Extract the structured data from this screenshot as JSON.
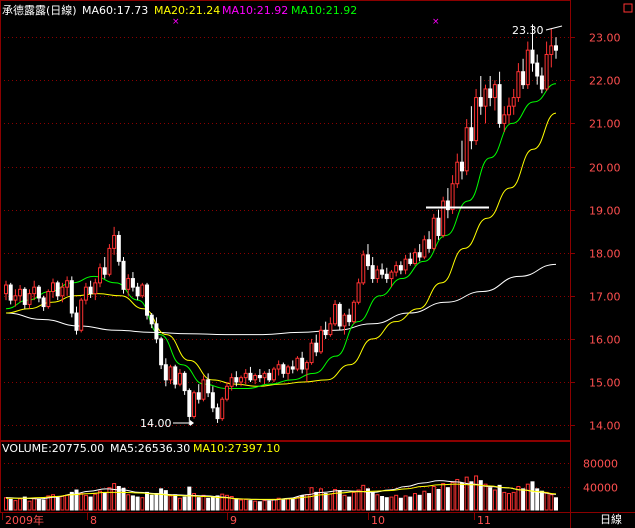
{
  "header": {
    "title": "承德露露(日線)",
    "ma60": "MA60:17.73",
    "ma20": "MA20:21.24",
    "ma10a": "MA10:21.92",
    "ma10b": "MA10:21.92"
  },
  "volume_header": {
    "volume": "VOLUME:20775.00",
    "ma5": "MA5:26536.30",
    "ma10": "MA10:27397.10"
  },
  "annotations": {
    "high": "23.30",
    "low": "14.00"
  },
  "period_label": "日線",
  "colors": {
    "bg": "#000000",
    "up": "#ff3232",
    "down": "#ffffff",
    "grid": "#8b0000",
    "axis_text": "#ff5050",
    "ma_white": "#ffffff",
    "ma_yellow": "#ffff00",
    "ma_green": "#00ff00",
    "magenta": "#ff00ff"
  },
  "chart_data": {
    "type": "candlestick",
    "price_ticks": [
      "23.00",
      "22.00",
      "21.00",
      "20.00",
      "19.00",
      "18.00",
      "17.00",
      "16.00",
      "15.00",
      "14.00"
    ],
    "volume_ticks": [
      "80000",
      "40000"
    ],
    "x_labels": [
      "2009年",
      "8",
      "9",
      "10",
      "11"
    ],
    "ylim": [
      13.7,
      23.4
    ],
    "vol_ylim": [
      0,
      92000
    ],
    "horizontal_line": 19.05,
    "candles": [
      [
        17.05,
        17.35,
        16.9,
        17.25,
        21000
      ],
      [
        17.25,
        17.3,
        16.8,
        16.9,
        18000
      ],
      [
        16.9,
        17.15,
        16.75,
        17.0,
        16000
      ],
      [
        17.0,
        17.25,
        16.85,
        17.15,
        19000
      ],
      [
        17.15,
        17.2,
        16.7,
        16.8,
        22000
      ],
      [
        16.8,
        17.15,
        16.7,
        17.05,
        15000
      ],
      [
        17.05,
        17.35,
        16.9,
        17.2,
        20000
      ],
      [
        17.2,
        17.25,
        16.85,
        16.95,
        18000
      ],
      [
        16.95,
        17.0,
        16.65,
        16.75,
        17000
      ],
      [
        16.75,
        17.15,
        16.7,
        17.1,
        24000
      ],
      [
        17.1,
        17.4,
        16.95,
        17.3,
        26000
      ],
      [
        17.3,
        17.35,
        16.9,
        17.0,
        21000
      ],
      [
        17.0,
        17.3,
        16.85,
        17.2,
        23000
      ],
      [
        17.2,
        17.45,
        17.0,
        17.35,
        25000
      ],
      [
        17.35,
        17.45,
        16.5,
        16.6,
        30000
      ],
      [
        16.6,
        16.75,
        16.1,
        16.2,
        34000
      ],
      [
        16.2,
        16.95,
        16.15,
        16.9,
        28000
      ],
      [
        16.9,
        17.3,
        16.8,
        17.2,
        25000
      ],
      [
        17.2,
        17.35,
        16.95,
        17.05,
        22000
      ],
      [
        17.05,
        17.4,
        16.9,
        17.3,
        27000
      ],
      [
        17.3,
        17.75,
        17.2,
        17.65,
        32000
      ],
      [
        17.65,
        17.9,
        17.4,
        17.5,
        29000
      ],
      [
        17.5,
        18.2,
        17.45,
        18.1,
        38000
      ],
      [
        18.1,
        18.6,
        17.95,
        18.4,
        45000
      ],
      [
        18.4,
        18.5,
        17.7,
        17.8,
        40000
      ],
      [
        17.8,
        17.9,
        17.05,
        17.15,
        37000
      ],
      [
        17.15,
        17.5,
        17.0,
        17.4,
        26000
      ],
      [
        17.4,
        17.55,
        17.1,
        17.2,
        24000
      ],
      [
        17.2,
        17.3,
        16.9,
        17.0,
        22000
      ],
      [
        17.0,
        17.3,
        16.95,
        17.25,
        21000
      ],
      [
        17.25,
        17.3,
        16.45,
        16.55,
        30000
      ],
      [
        16.55,
        16.6,
        16.25,
        16.35,
        25000
      ],
      [
        16.35,
        16.5,
        15.9,
        16.0,
        28000
      ],
      [
        16.0,
        16.05,
        15.3,
        15.4,
        36000
      ],
      [
        15.4,
        15.55,
        14.9,
        15.05,
        33000
      ],
      [
        15.05,
        15.4,
        14.95,
        15.35,
        24000
      ],
      [
        15.35,
        15.4,
        14.85,
        14.95,
        26000
      ],
      [
        14.95,
        15.3,
        14.9,
        15.2,
        20000
      ],
      [
        15.2,
        15.25,
        14.7,
        14.8,
        22000
      ],
      [
        14.8,
        14.85,
        14.0,
        14.2,
        39000
      ],
      [
        14.2,
        14.8,
        14.15,
        14.75,
        28000
      ],
      [
        14.75,
        14.95,
        14.5,
        14.6,
        21000
      ],
      [
        14.6,
        15.15,
        14.55,
        15.05,
        25000
      ],
      [
        15.05,
        15.2,
        14.65,
        14.75,
        20000
      ],
      [
        14.75,
        14.9,
        14.3,
        14.4,
        22000
      ],
      [
        14.4,
        14.5,
        14.05,
        14.15,
        24000
      ],
      [
        14.15,
        14.65,
        14.1,
        14.6,
        27000
      ],
      [
        14.6,
        15.0,
        14.55,
        14.9,
        25000
      ],
      [
        14.9,
        15.2,
        14.8,
        15.1,
        23000
      ],
      [
        15.1,
        15.25,
        14.9,
        15.0,
        19000
      ],
      [
        15.0,
        15.15,
        14.9,
        15.1,
        17000
      ],
      [
        15.1,
        15.3,
        14.95,
        15.2,
        18000
      ],
      [
        15.2,
        15.35,
        15.0,
        15.05,
        16000
      ],
      [
        15.05,
        15.2,
        14.95,
        15.15,
        15000
      ],
      [
        15.15,
        15.3,
        15.0,
        15.1,
        14000
      ],
      [
        15.1,
        15.25,
        14.95,
        15.2,
        16000
      ],
      [
        15.2,
        15.3,
        15.0,
        15.05,
        15000
      ],
      [
        15.05,
        15.35,
        15.0,
        15.3,
        18000
      ],
      [
        15.3,
        15.5,
        15.15,
        15.4,
        20000
      ],
      [
        15.4,
        15.45,
        15.1,
        15.2,
        17000
      ],
      [
        15.2,
        15.4,
        15.05,
        15.35,
        19000
      ],
      [
        15.35,
        15.5,
        15.2,
        15.3,
        18000
      ],
      [
        15.3,
        15.6,
        15.25,
        15.55,
        22000
      ],
      [
        15.55,
        15.7,
        15.2,
        15.3,
        24000
      ],
      [
        15.3,
        15.5,
        15.0,
        15.45,
        26000
      ],
      [
        15.45,
        16.0,
        15.4,
        15.9,
        38000
      ],
      [
        15.9,
        16.1,
        15.6,
        15.7,
        30000
      ],
      [
        15.7,
        16.3,
        15.65,
        16.2,
        36000
      ],
      [
        16.2,
        16.4,
        16.0,
        16.1,
        28000
      ],
      [
        16.1,
        16.5,
        16.05,
        16.35,
        27000
      ],
      [
        16.35,
        16.9,
        16.3,
        16.8,
        35000
      ],
      [
        16.8,
        16.85,
        16.2,
        16.3,
        33000
      ],
      [
        16.3,
        16.6,
        16.1,
        16.55,
        25000
      ],
      [
        16.55,
        16.7,
        16.3,
        16.4,
        22000
      ],
      [
        16.4,
        16.9,
        16.35,
        16.85,
        30000
      ],
      [
        16.85,
        17.4,
        16.8,
        17.3,
        34000
      ],
      [
        17.3,
        18.05,
        17.25,
        17.95,
        42000
      ],
      [
        17.95,
        18.2,
        17.6,
        17.7,
        36000
      ],
      [
        17.7,
        17.9,
        17.3,
        17.4,
        30000
      ],
      [
        17.4,
        17.7,
        17.3,
        17.6,
        26000
      ],
      [
        17.6,
        17.75,
        17.4,
        17.5,
        23000
      ],
      [
        17.5,
        17.65,
        17.3,
        17.4,
        21000
      ],
      [
        17.4,
        17.6,
        17.2,
        17.55,
        22000
      ],
      [
        17.55,
        17.8,
        17.45,
        17.7,
        25000
      ],
      [
        17.7,
        17.8,
        17.5,
        17.6,
        20000
      ],
      [
        17.6,
        17.95,
        17.5,
        17.85,
        24000
      ],
      [
        17.85,
        18.0,
        17.7,
        17.75,
        22000
      ],
      [
        17.75,
        18.1,
        17.7,
        18.0,
        28000
      ],
      [
        18.0,
        18.2,
        17.8,
        17.9,
        25000
      ],
      [
        17.9,
        18.4,
        17.85,
        18.3,
        32000
      ],
      [
        18.3,
        18.5,
        18.0,
        18.1,
        28000
      ],
      [
        18.1,
        18.9,
        18.05,
        18.8,
        40000
      ],
      [
        18.8,
        19.0,
        18.3,
        18.4,
        35000
      ],
      [
        18.4,
        19.3,
        18.35,
        19.2,
        45000
      ],
      [
        19.2,
        19.5,
        18.8,
        19.0,
        38000
      ],
      [
        19.0,
        19.8,
        18.9,
        19.6,
        47000
      ],
      [
        19.6,
        20.3,
        19.5,
        20.1,
        52000
      ],
      [
        20.1,
        20.6,
        19.7,
        19.9,
        46000
      ],
      [
        19.9,
        21.1,
        19.8,
        20.9,
        56000
      ],
      [
        20.9,
        21.4,
        20.4,
        20.6,
        48000
      ],
      [
        20.6,
        21.8,
        20.5,
        21.6,
        58000
      ],
      [
        21.6,
        22.1,
        21.2,
        21.4,
        50000
      ],
      [
        21.4,
        21.9,
        21.0,
        21.8,
        44000
      ],
      [
        21.8,
        22.1,
        21.4,
        21.6,
        38000
      ],
      [
        21.6,
        22.0,
        21.3,
        21.9,
        34000
      ],
      [
        21.9,
        22.2,
        20.9,
        21.0,
        42000
      ],
      [
        21.0,
        21.4,
        20.8,
        21.2,
        30000
      ],
      [
        21.2,
        21.6,
        21.0,
        21.4,
        28000
      ],
      [
        21.4,
        21.8,
        21.2,
        21.6,
        30000
      ],
      [
        21.6,
        22.4,
        21.5,
        22.2,
        40000
      ],
      [
        22.2,
        22.5,
        21.8,
        21.9,
        36000
      ],
      [
        21.9,
        22.9,
        21.8,
        22.7,
        44000
      ],
      [
        22.7,
        23.3,
        22.2,
        22.4,
        48000
      ],
      [
        22.4,
        22.6,
        21.9,
        22.1,
        36000
      ],
      [
        22.1,
        22.3,
        21.7,
        21.8,
        32000
      ],
      [
        21.8,
        22.9,
        21.75,
        22.6,
        30000
      ],
      [
        22.6,
        23.2,
        22.3,
        22.8,
        26000
      ],
      [
        22.8,
        23.0,
        22.5,
        22.7,
        20775
      ]
    ],
    "ma_white": [
      16.6,
      16.45,
      16.3,
      16.2,
      16.15,
      16.12,
      16.1,
      16.1,
      16.15,
      16.2,
      16.35,
      16.6,
      16.85,
      17.1,
      17.45,
      17.73
    ],
    "ma_yellow": [
      16.6,
      16.7,
      16.85,
      17.0,
      17.05,
      17.0,
      16.7,
      16.1,
      15.5,
      15.05,
      14.95,
      14.9,
      14.95,
      15.0,
      15.05,
      15.4,
      16.0,
      16.4,
      16.7,
      17.3,
      18.1,
      18.8,
      19.5,
      20.4,
      21.24
    ],
    "ma_green": [
      16.7,
      16.9,
      17.1,
      17.3,
      17.45,
      17.3,
      16.9,
      16.1,
      15.4,
      14.95,
      14.85,
      14.85,
      14.95,
      15.05,
      15.2,
      15.6,
      16.4,
      17.0,
      17.4,
      17.8,
      18.4,
      19.2,
      20.2,
      21.0,
      21.5,
      21.92
    ],
    "vol_ma5": [
      21000,
      20000,
      19000,
      22000,
      27000,
      32000,
      36000,
      34000,
      30000,
      28000,
      26000,
      25000,
      24000,
      22000,
      19000,
      18000,
      17000,
      20000,
      26000,
      30000,
      33000,
      32000,
      30000,
      34000,
      40000,
      46000,
      50000,
      48000,
      44000,
      40000,
      38000,
      34000,
      30000,
      26536
    ],
    "vol_ma10": [
      20000,
      20000,
      21000,
      23000,
      26000,
      28000,
      30000,
      30000,
      29000,
      27000,
      25000,
      24000,
      23000,
      21000,
      19000,
      18000,
      18000,
      19000,
      22000,
      26000,
      29000,
      31000,
      32000,
      33000,
      36000,
      40000,
      43000,
      44000,
      43000,
      41000,
      38000,
      34000,
      31000,
      27397
    ]
  }
}
